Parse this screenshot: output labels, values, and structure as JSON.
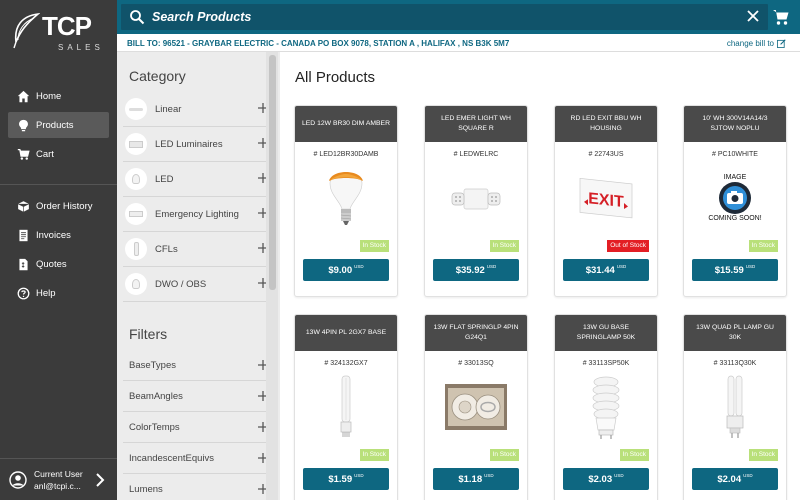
{
  "brand": {
    "name": "TCP",
    "sub": "SALES"
  },
  "search": {
    "placeholder": "Search Products"
  },
  "billing": {
    "text": "BILL TO: 96521 - GRAYBAR ELECTRIC - CANADA PO BOX 9078, STATION A , HALIFAX , NS B3K 5M7",
    "change_label": "change bill to"
  },
  "nav": {
    "main": [
      {
        "label": "Home",
        "icon": "home-icon"
      },
      {
        "label": "Products",
        "icon": "lightbulb-icon",
        "active": true
      },
      {
        "label": "Cart",
        "icon": "cart-icon"
      }
    ],
    "secondary": [
      {
        "label": "Order History",
        "icon": "box-icon"
      },
      {
        "label": "Invoices",
        "icon": "invoice-icon"
      },
      {
        "label": "Quotes",
        "icon": "quote-icon"
      },
      {
        "label": "Help",
        "icon": "help-icon"
      }
    ]
  },
  "user": {
    "title": "Current User",
    "email": "anl@tcpi.c..."
  },
  "category": {
    "heading": "Category",
    "items": [
      "Linear",
      "LED Luminaires",
      "LED",
      "Emergency Lighting",
      "CFLs",
      "DWO / OBS"
    ]
  },
  "filters": {
    "heading": "Filters",
    "items": [
      "BaseTypes",
      "BeamAngles",
      "ColorTemps",
      "IncandescentEquivs",
      "Lumens"
    ]
  },
  "products": {
    "title": "All Products",
    "currency": "USD",
    "items": [
      {
        "name": "LED 12W BR30 DIM AMBER",
        "sku": "# LED12BR30DAMB",
        "stock": "In Stock",
        "in_stock": true,
        "price": "$9.00",
        "img": "amber-bulb"
      },
      {
        "name": "LED EMER LIGHT WH SQUARE R",
        "sku": "# LEDWELRC",
        "stock": "In Stock",
        "in_stock": true,
        "price": "$35.92",
        "img": "emergency-light"
      },
      {
        "name": "RD LED EXIT BBU WH HOUSING",
        "sku": "# 22743US",
        "stock": "Out of Stock",
        "in_stock": false,
        "price": "$31.44",
        "img": "exit-sign"
      },
      {
        "name": "10' WH 300V14A14/3 SJTOW NOPLU",
        "sku": "# PC10WHITE",
        "stock": "In Stock",
        "in_stock": true,
        "price": "$15.59",
        "img": "image-coming-soon",
        "placeholder_lines": [
          "IMAGE",
          "COMING SOON!"
        ]
      },
      {
        "name": "13W 4PIN PL 2GX7 BASE",
        "sku": "# 324132GX7",
        "stock": "In Stock",
        "in_stock": true,
        "price": "$1.59",
        "img": "pl-lamp"
      },
      {
        "name": "13W FLAT SPRINGLP 4PIN G24Q1",
        "sku": "# 33013SQ",
        "stock": "In Stock",
        "in_stock": true,
        "price": "$1.18",
        "img": "flat-lamp"
      },
      {
        "name": "13W GU BASE SPRINGLAMP 50K",
        "sku": "# 33113SP50K",
        "stock": "In Stock",
        "in_stock": true,
        "price": "$2.03",
        "img": "spiral-lamp"
      },
      {
        "name": "13W QUAD PL LAMP GU 30K",
        "sku": "# 33113Q30K",
        "stock": "In Stock",
        "in_stock": true,
        "price": "$2.04",
        "img": "quad-lamp"
      }
    ]
  },
  "colors": {
    "primary": "#0e6781",
    "sidebar": "#3b3b3b",
    "in_stock": "#b9e07a",
    "out_of_stock": "#e31e24",
    "card_header": "#4a4a4a"
  }
}
